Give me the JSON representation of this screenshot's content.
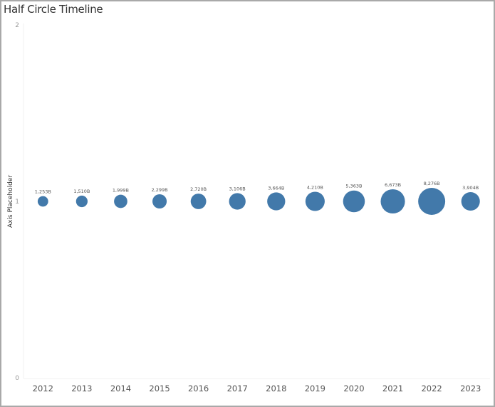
{
  "chart_data": {
    "type": "scatter",
    "title": "Half Circle Timeline",
    "xlabel": "",
    "ylabel": "Axis Placeholder",
    "ylim": [
      0,
      2
    ],
    "yticks": [
      "0",
      "1",
      "2"
    ],
    "grid": false,
    "categories": [
      "2012",
      "2013",
      "2014",
      "2015",
      "2016",
      "2017",
      "2018",
      "2019",
      "2020",
      "2021",
      "2022",
      "2023"
    ],
    "y": [
      1,
      1,
      1,
      1,
      1,
      1,
      1,
      1,
      1,
      1,
      1,
      1
    ],
    "size_values": [
      1253,
      1510,
      1999,
      2299,
      2720,
      3106,
      3664,
      4210,
      5363,
      6673,
      8276,
      3904
    ],
    "size_unit": "B",
    "labels": [
      "1,253B",
      "1,510B",
      "1,999B",
      "2,299B",
      "2,720B",
      "3,106B",
      "3,664B",
      "4,210B",
      "5,363B",
      "6,673B",
      "8,276B",
      "3,904B"
    ],
    "color": "#4279aa"
  }
}
